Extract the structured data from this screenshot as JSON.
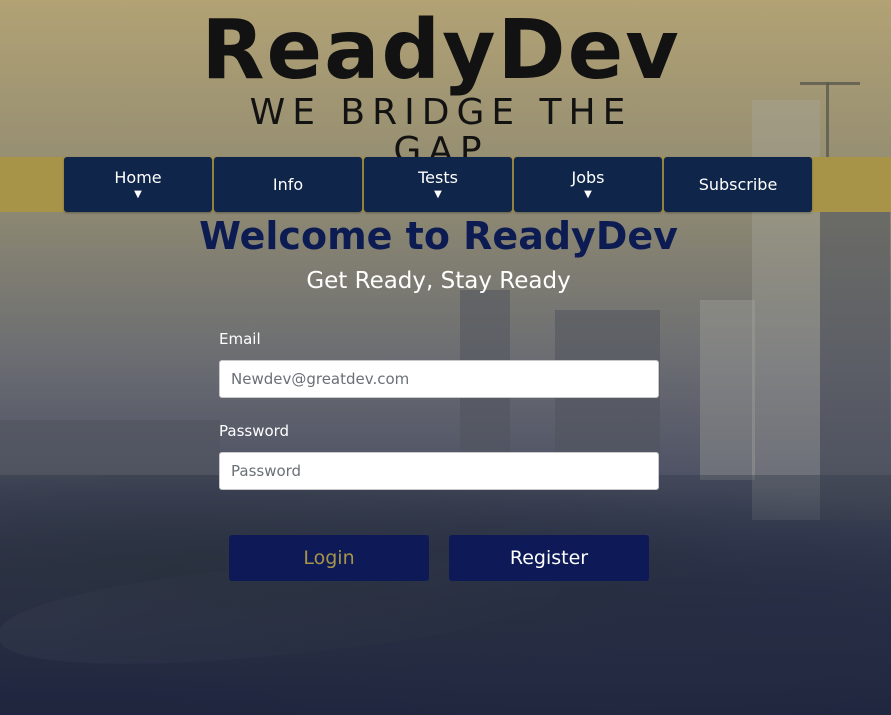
{
  "logo": {
    "title": "ReadyDev",
    "tagline": "WE BRIDGE THE GAP"
  },
  "nav": {
    "items": [
      {
        "label": "Home",
        "has_dropdown": true
      },
      {
        "label": "Info",
        "has_dropdown": false
      },
      {
        "label": "Tests",
        "has_dropdown": true
      },
      {
        "label": "Jobs",
        "has_dropdown": true
      },
      {
        "label": "Subscribe",
        "has_dropdown": false
      }
    ],
    "caret": "▼"
  },
  "hero": {
    "title": "Welcome to ReadyDev",
    "subtitle": "Get Ready, Stay Ready"
  },
  "form": {
    "email_label": "Email",
    "email_placeholder": "Newdev@greatdev.com",
    "password_label": "Password",
    "password_placeholder": "Password",
    "login_label": "Login",
    "register_label": "Register"
  },
  "colors": {
    "nav_bg": "#10254a",
    "nav_band": "#a89449",
    "button_bg": "#0d1a57",
    "login_text": "#a89449",
    "title_color": "#0c1c52"
  }
}
